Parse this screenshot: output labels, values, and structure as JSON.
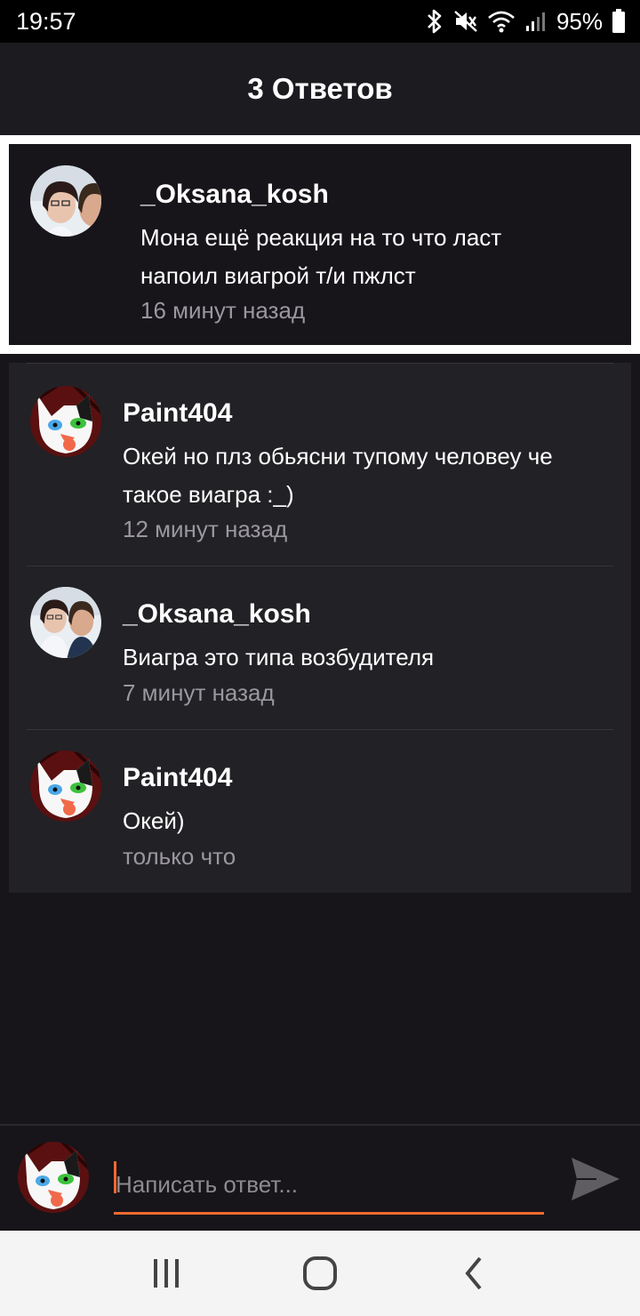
{
  "status": {
    "time": "19:57",
    "battery": "95%",
    "icons": [
      "bluetooth-icon",
      "mute-icon",
      "wifi-icon",
      "signal-icon",
      "battery-icon"
    ]
  },
  "header": {
    "title": "3 Ответов"
  },
  "parent_comment": {
    "author": "_Oksana_kosh",
    "text": "Мона ещё реакция на то что ласт напоил виагрой т/и пжлст",
    "time": "16 минут назад",
    "avatar": "oksana-avatar"
  },
  "replies": [
    {
      "author": "Paint404",
      "text": "Окей но плз обьясни тупому человеу че такое виагра :_)",
      "time": "12 минут назад",
      "avatar": "paint-avatar"
    },
    {
      "author": "_Oksana_kosh",
      "text": "Виагра это типа возбудителя",
      "time": "7 минут назад",
      "avatar": "oksana-avatar"
    },
    {
      "author": "Paint404",
      "text": "Окей)",
      "time": "только что",
      "avatar": "paint-avatar"
    }
  ],
  "compose": {
    "placeholder": "Написать ответ...",
    "value": ""
  },
  "colors": {
    "accent": "#f2692f",
    "background": "#17151a",
    "reply_bg": "#222125",
    "header_bg": "#1c1b1f"
  }
}
